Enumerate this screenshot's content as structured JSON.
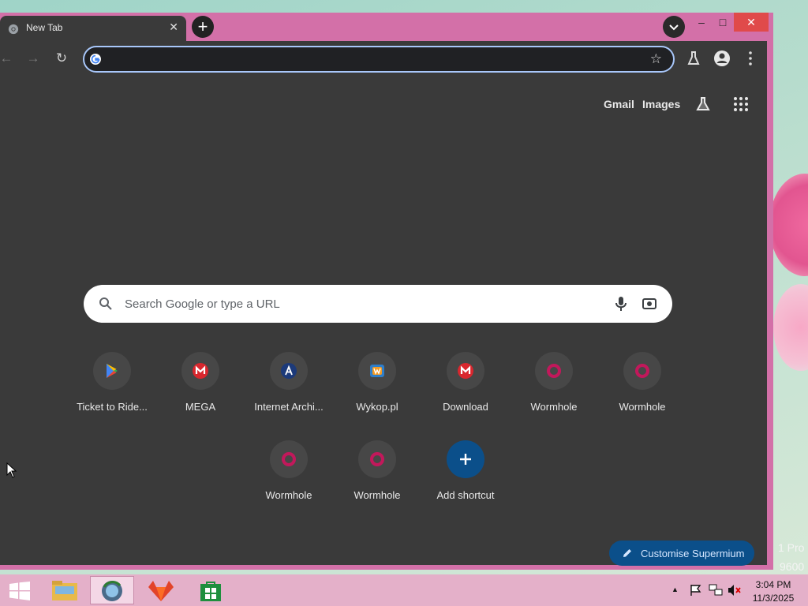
{
  "wallpaper": {
    "overlay_text_1": "1 Pro",
    "overlay_text_2": "9600"
  },
  "browser": {
    "tab": {
      "title": "New Tab",
      "close_glyph": "✕"
    },
    "new_tab_glyph": "+",
    "window_controls": {
      "minimize": "–",
      "maximize": "□",
      "close": "✕"
    },
    "toolbar": {
      "back_glyph": "←",
      "forward_glyph": "→",
      "reload_glyph": "↻",
      "omnibox_value": "",
      "star_glyph": "☆"
    },
    "newtab": {
      "links": {
        "gmail": "Gmail",
        "images": "Images"
      },
      "search_placeholder": "Search Google or type a URL",
      "shortcuts": [
        {
          "label": "Ticket to Ride...",
          "icon": "play-store-icon"
        },
        {
          "label": "MEGA",
          "icon": "mega-icon"
        },
        {
          "label": "Internet Archi...",
          "icon": "internet-archive-icon"
        },
        {
          "label": "Wykop.pl",
          "icon": "wykop-icon"
        },
        {
          "label": "Download",
          "icon": "mega-icon"
        },
        {
          "label": "Wormhole",
          "icon": "wormhole-icon"
        },
        {
          "label": "Wormhole",
          "icon": "wormhole-icon"
        },
        {
          "label": "Wormhole",
          "icon": "wormhole-icon"
        },
        {
          "label": "Wormhole",
          "icon": "wormhole-icon"
        },
        {
          "label": "Add shortcut",
          "icon": "plus-icon"
        }
      ],
      "customise_label": "Customise Supermium"
    },
    "colors": {
      "frame": "#d370a8",
      "content_bg": "#3a3a3a",
      "accent": "#0b4f8a"
    }
  },
  "taskbar": {
    "time": "3:04 PM",
    "date": "11/3/2025",
    "tray_arrow": "▲"
  }
}
